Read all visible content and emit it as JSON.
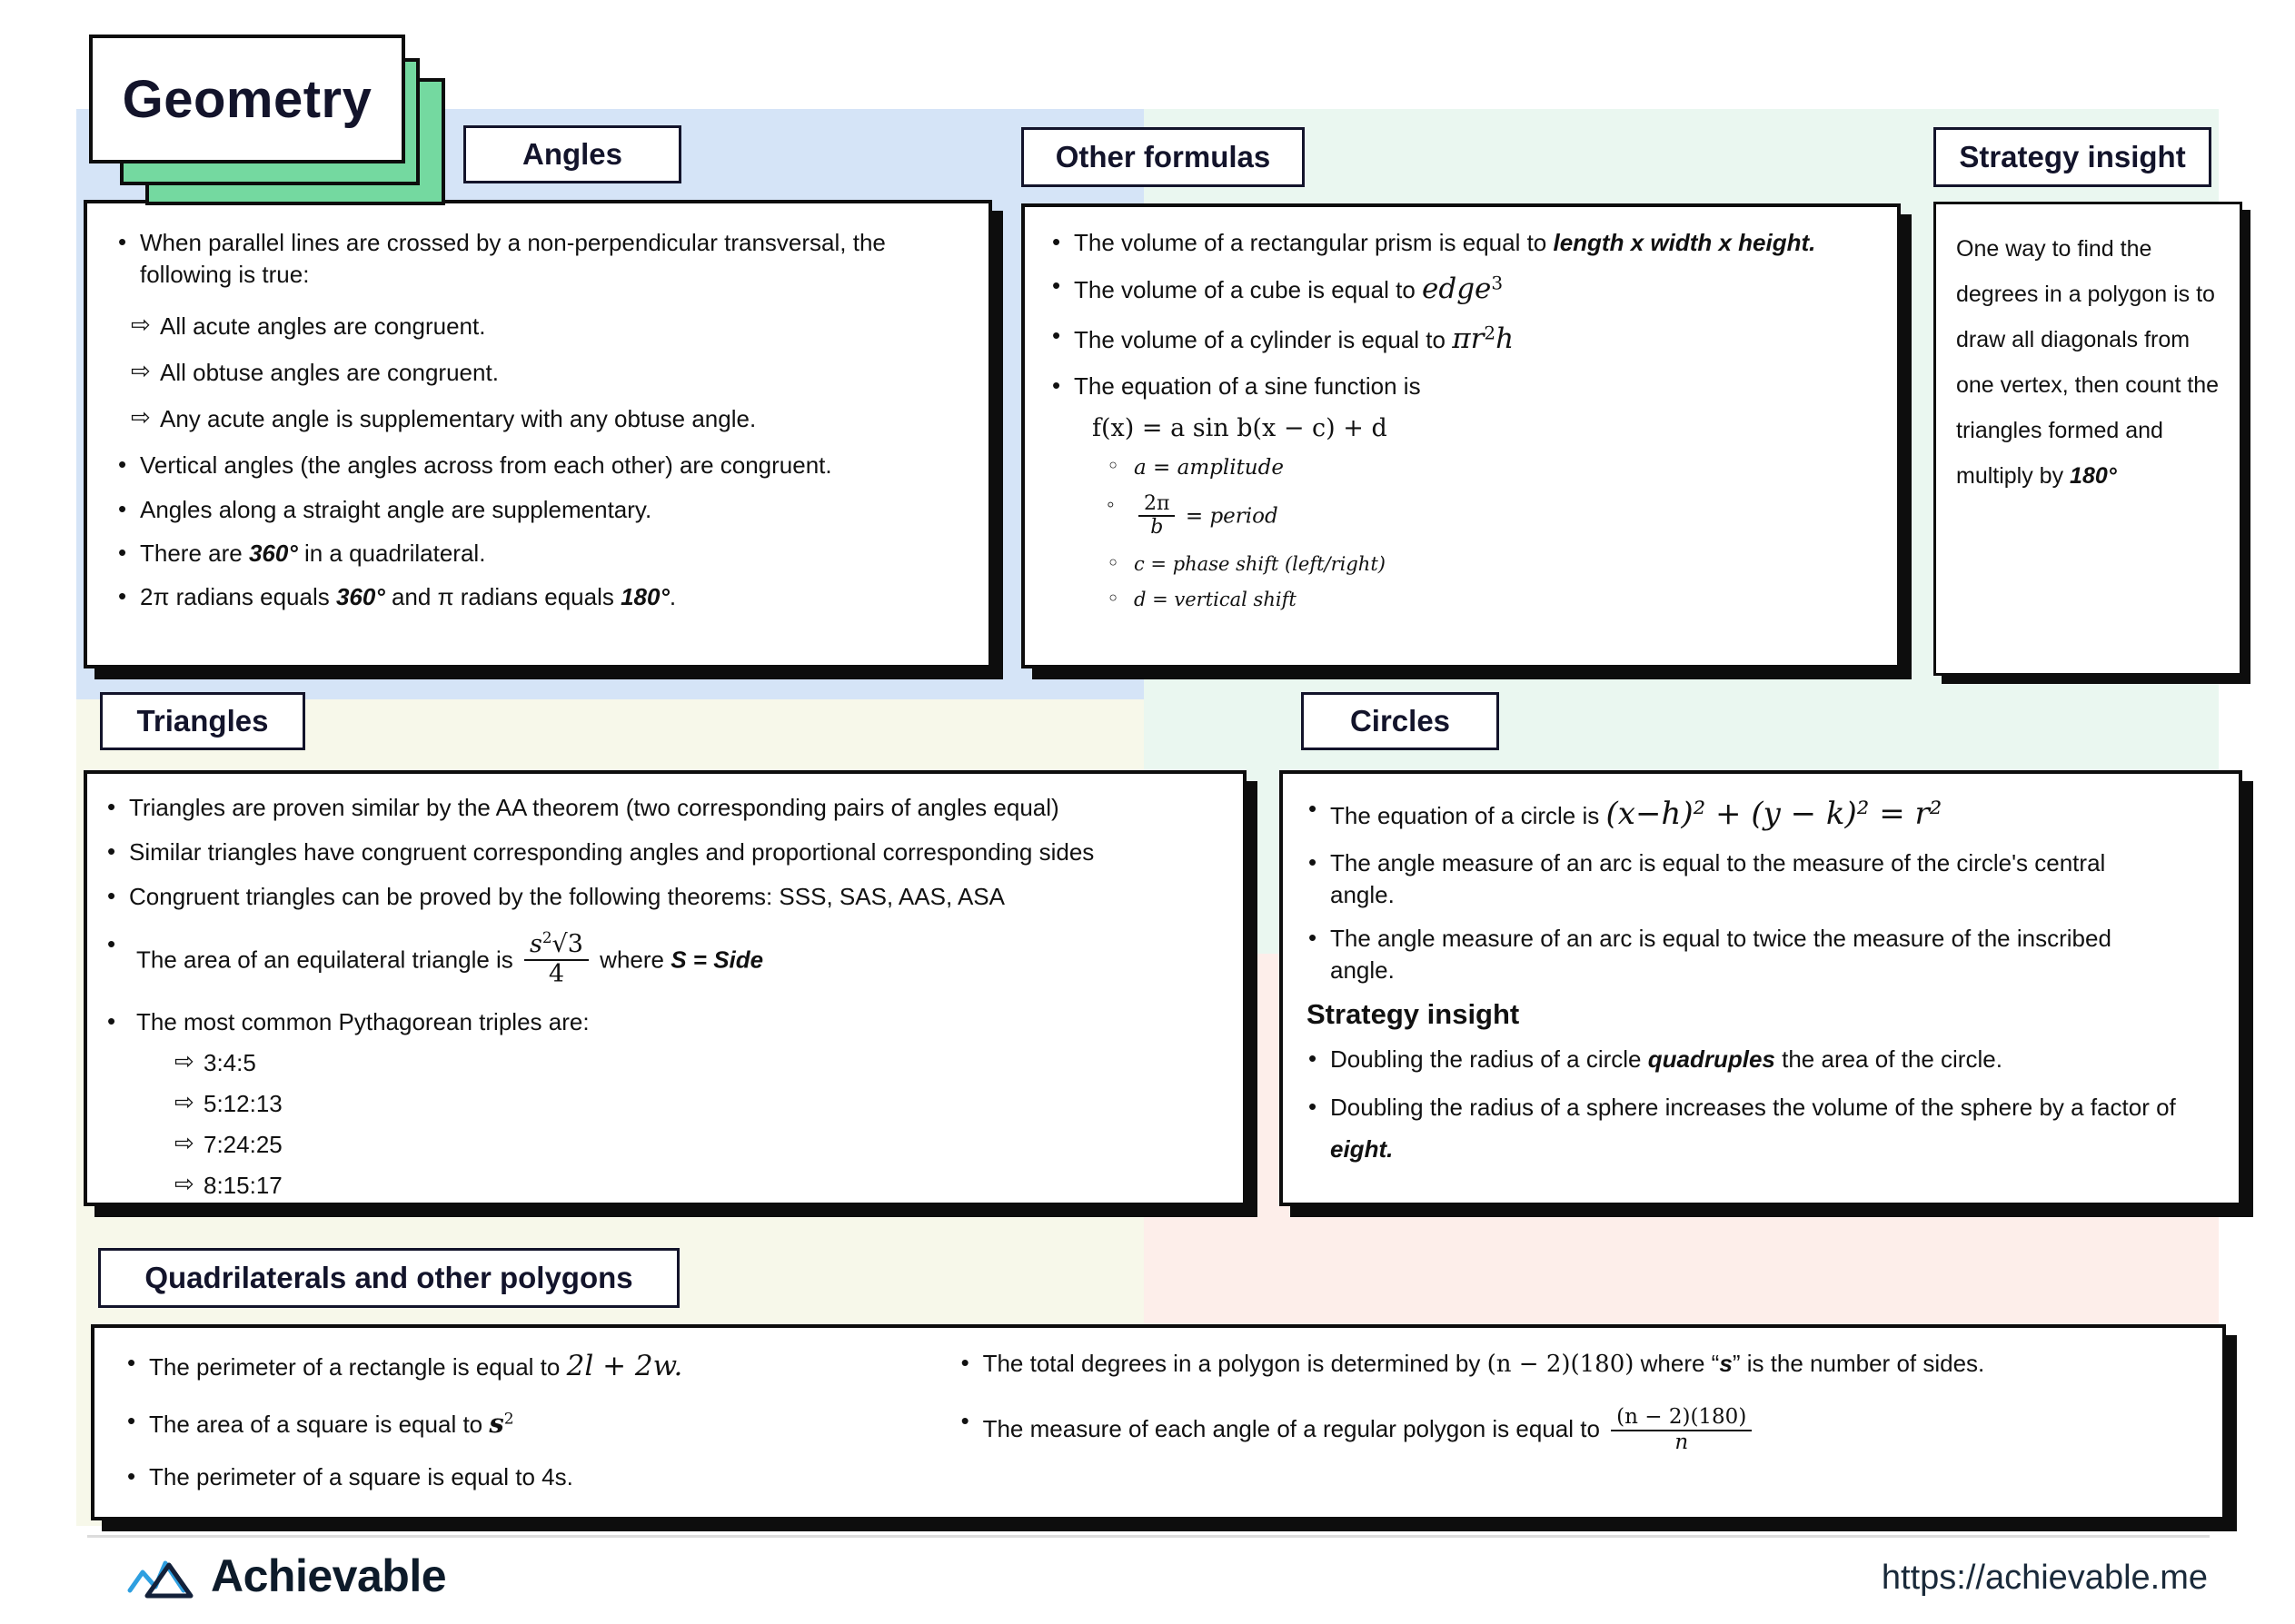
{
  "title": "Geometry",
  "sections": {
    "angles": {
      "tag": "Angles",
      "intro": "When parallel lines are crossed by a non-perpendicular transversal, the following is true:",
      "sub_items": [
        "All acute angles are congruent.",
        "All obtuse angles are congruent.",
        "Any acute angle is supplementary with any obtuse angle."
      ],
      "bullets": [
        "Vertical angles (the angles across from each other) are congruent.",
        "Angles along a straight angle are supplementary."
      ],
      "quad_prefix": "There are ",
      "quad_value": "360°",
      "quad_suffix": " in a quadrilateral.",
      "radians_a": "2π radians equals ",
      "radians_v1": "360°",
      "radians_b": " and π radians equals ",
      "radians_v2": "180°",
      "radians_c": "."
    },
    "other_formulas": {
      "tag": "Other formulas",
      "prism_prefix": "The volume of a rectangular prism is equal to ",
      "prism_value": "length x width x height.",
      "cube_prefix": "The volume of a cube is equal to ",
      "cube_value": "edge",
      "cube_exp": "3",
      "cylinder_prefix": "The volume of a cylinder is equal to ",
      "cylinder_pi": "πr",
      "cylinder_exp": "2",
      "cylinder_h": "h",
      "sine_label": "The equation of a sine function is",
      "sine_equation": "f(x)  =  a  sin b(x − c) + d",
      "amplitude": "a = amplitude",
      "period_num": "2π",
      "period_den": "b",
      "period_label": "= period",
      "phase": "c = phase shift (left/right)",
      "vertical": "d = vertical shift"
    },
    "strategy_insight_top": {
      "tag": "Strategy insight",
      "body_prefix": "One way to find the degrees in a polygon is to draw all diagonals from one vertex, then count the triangles formed and multiply by ",
      "body_value": "180°"
    },
    "triangles": {
      "tag": "Triangles",
      "bullets": [
        "Triangles are proven similar by the AA theorem (two corresponding pairs of angles equal)",
        "Similar triangles have congruent corresponding angles and proportional corresponding sides",
        "Congruent triangles can be proved by the following theorems: SSS, SAS, AAS, ASA"
      ],
      "area_prefix": "The area of an equilateral triangle is ",
      "area_num_s": "s",
      "area_num_exp": "2",
      "area_num_root": "√3",
      "area_den": "4",
      "area_where": "where ",
      "area_where_value": "S = Side",
      "triples_label": "The most common Pythagorean triples are:",
      "triples": [
        "3:4:5",
        "5:12:13",
        "7:24:25",
        "8:15:17"
      ]
    },
    "circles": {
      "tag": "Circles",
      "equation_prefix": "The equation of a circle is ",
      "equation": "(x−h)² + (y − k)² = r²",
      "bullets": [
        "The angle measure of an arc is equal to the measure of the circle's central angle.",
        "The angle measure of an arc is equal to twice the measure of the inscribed angle."
      ],
      "strategy_heading": "Strategy insight",
      "strategy_1_prefix": "Doubling the radius of a circle ",
      "strategy_1_value": "quadruples",
      "strategy_1_suffix": " the area of the circle.",
      "strategy_2_prefix": "Doubling the radius of a sphere increases the volume of the sphere by a factor of ",
      "strategy_2_value": "eight."
    },
    "quadrilaterals": {
      "tag": "Quadrilaterals and other polygons",
      "rect_prefix": "The perimeter of a rectangle is equal to ",
      "rect_value": "2l + 2w.",
      "square_area_prefix": "The area of a square is equal to ",
      "square_area_value": "s",
      "square_area_exp": "2",
      "square_perimeter": "The perimeter of a square is equal to 4s.",
      "total_prefix": "The total degrees in a polygon is determined by ",
      "total_formula": "(n − 2)(180)",
      "total_mid": " where “",
      "total_var": "s",
      "total_suffix": "” is the number of sides.",
      "regular_prefix": "The measure of each angle of a regular polygon is equal to ",
      "regular_num": "(n − 2)(180)",
      "regular_den": "n"
    }
  },
  "footer": {
    "brand": "Achievable",
    "url": "https://achievable.me"
  },
  "colors": {
    "accent_green": "#74d9a0",
    "ink": "#0d0d0d",
    "blue_field": "#d5e4f7",
    "mint_field": "#eaf7f0",
    "cream_field": "#f7f8ea",
    "pink_field": "#fdeeea"
  }
}
